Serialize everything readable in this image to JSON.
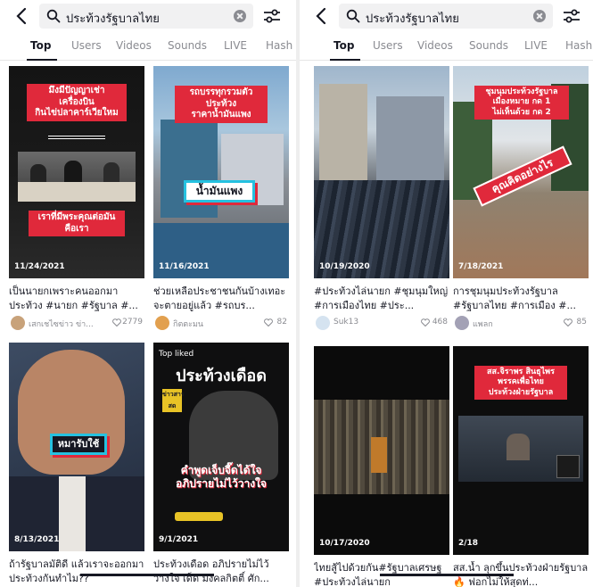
{
  "search": {
    "query": "ประท้วงรัฐบาลไทย"
  },
  "tabs": [
    "Top",
    "Users",
    "Videos",
    "Sounds",
    "LIVE",
    "Hash"
  ],
  "active_tab": "Top",
  "left_cards": [
    {
      "overlay_lines": [
        "มึงมีปัญญาเช่า",
        "เครื่องบิน",
        "กินไข่ปลาคาร์เวียใหม"
      ],
      "overlay_bottom": [
        "เราที่มีพระคุณต่อมัน",
        "คือเรา"
      ],
      "date": "11/24/2021",
      "caption": "เป็นนายกเพราะคนออกมาประท้วง #นายก #รัฐบาล #...",
      "author": "เสกเชไซข่าว ข่า...",
      "likes": "2779"
    },
    {
      "overlay_lines": [
        "รถบรรทุกรวมตัว",
        "ประท้วง",
        "ราคาน้ำมันแพง"
      ],
      "overlay_pill": "น้ำมันแพง",
      "date": "11/16/2021",
      "caption": "ช่วยเหลือประชาชนกันบ้างเทอะจะตายอยู่แล้ว #รถบร...",
      "author": "กิตตะมน",
      "likes": "82"
    },
    {
      "overlay_pill": "หมารับใช้",
      "date": "8/13/2021",
      "caption": "ถ้ารัฐบาลมัติดี แล้วเราจะออกมาประท้วงกันทำไม??",
      "author": "",
      "likes": ""
    },
    {
      "badge": "Top liked",
      "overlay_title": "ประท้วงเดือด",
      "overlay_lines": [
        "คำพูดเจ็บจี๊ดได้ใจ",
        "อภิปรายไม่ไว้วางใจ"
      ],
      "logo_text": "ข่าวสารสด",
      "date": "9/1/2021",
      "caption": "ประท้วงเดือด อภิปรายไม่ไว้วางใจ เด็ด มงคลกิตติ์ ศัก...",
      "author": "",
      "likes": ""
    }
  ],
  "right_cards": [
    {
      "date": "10/19/2020",
      "caption": "#ประท้วงไล่นายก #ชุมนุมใหญ่ #การเมืองไทย #ประ...",
      "author": "Suk13",
      "likes": "468"
    },
    {
      "overlay_lines": [
        "ชุมนุมประท้วงรัฐบาล",
        "เมืองหมาย กด 1",
        "ไม่เห็นด้วย กด 2"
      ],
      "overlay_stamp": "คุณคิดอย่างไร",
      "date": "7/18/2021",
      "caption": "การชุมนุมประท้วงรัฐบาล #รัฐบาลไทย #การเมือง #...",
      "author": "แพลก",
      "likes": "85"
    },
    {
      "date": "10/17/2020",
      "caption": "ไทยสู้ไปด้วยกัน#รัฐบาลเศรษฐ #ประท้วงไล่นายก",
      "author": "",
      "likes": ""
    },
    {
      "overlay_lines": [
        "สส.จิราพร สินธุไพร",
        "พรรคเพื่อไทย",
        "ประท้วงฝ่ายรัฐบาล"
      ],
      "date": "2/18",
      "caption": "สส.น้ำ ลุกขึ้นประท้วงฝ่ายรัฐบาล 🔥 ฟอกไม่ให้สุดท่...",
      "author": "",
      "likes": ""
    }
  ],
  "colors": {
    "accent_red": "#e0293b",
    "pill_border": "#25c1e0",
    "text_primary": "#161823",
    "text_secondary": "#8a8b91"
  }
}
